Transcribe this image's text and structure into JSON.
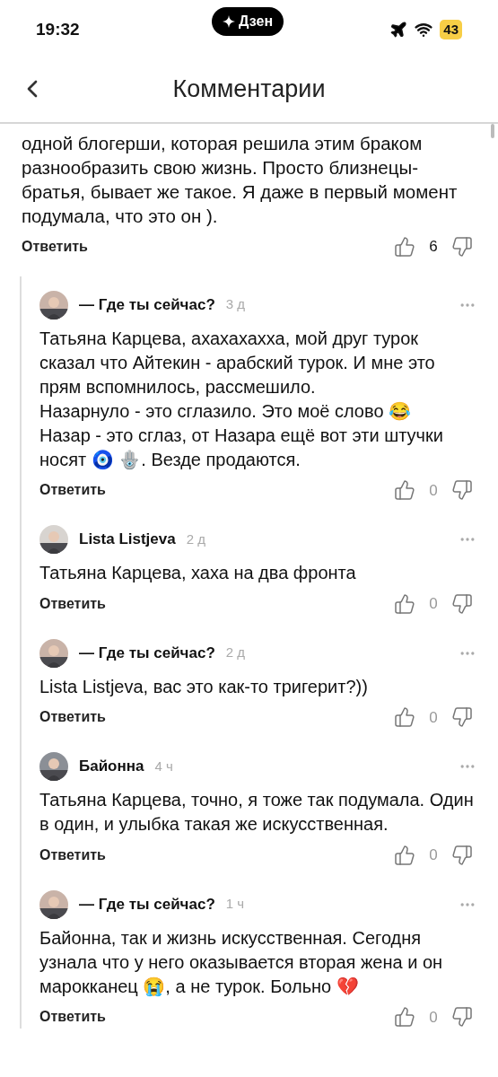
{
  "status_bar": {
    "time": "19:32",
    "pill": "Дзен",
    "battery": "43"
  },
  "header": {
    "title": "Комментарии"
  },
  "comment": {
    "text": "одной блогерши, которая решила этим браком разнообразить свою жизнь. Просто близнецы-братья, бывает же такое. Я даже в первый момент подумала, что это он ).",
    "reply": "Ответить",
    "likes": "6"
  },
  "replies": [
    {
      "author": "— Где ты сейчас?",
      "time": "3 д",
      "text": "Татьяна Карцева, ахахахахха, мой друг турок сказал что Айтекин - арабский турок. И мне это прям вспомнилось, рассмешило.\nНазарнуло - это сглазило. Это моё слово 😂\nНазар - это сглаз, от Назара ещё вот эти штучки носят 🧿 🪬. Везде продаются.",
      "reply": "Ответить",
      "likes": "0"
    },
    {
      "author": "Lista Listjeva",
      "time": "2 д",
      "text": "Татьяна Карцева, хаха на два фронта",
      "reply": "Ответить",
      "likes": "0"
    },
    {
      "author": "— Где ты сейчас?",
      "time": "2 д",
      "text": "Lista Listjeva, вас это как-то тригерит?))",
      "reply": "Ответить",
      "likes": "0"
    },
    {
      "author": "Байонна",
      "time": "4 ч",
      "text": "Татьяна Карцева, точно, я тоже так подумала. Один в один, и улыбка такая же искусственная.",
      "reply": "Ответить",
      "likes": "0"
    },
    {
      "author": "— Где ты сейчас?",
      "time": "1 ч",
      "text": "Байонна, так и жизнь искусственная. Сегодня узнала что у него оказывается вторая жена и он марокканец 😭, а не турок. Больно 💔",
      "reply": "Ответить",
      "likes": "0"
    }
  ]
}
